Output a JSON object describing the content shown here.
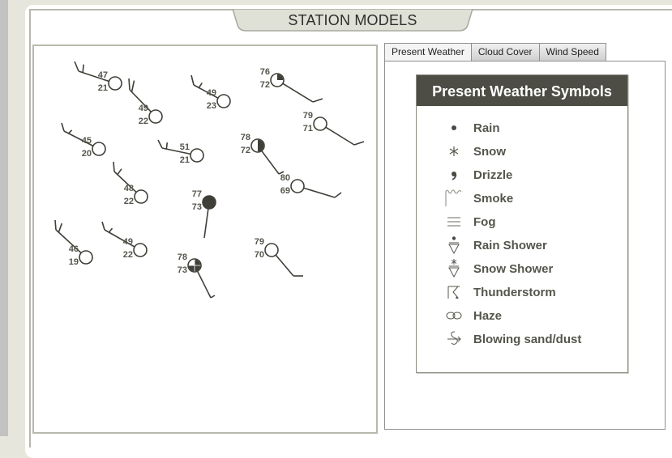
{
  "header": {
    "title": "STATION MODELS"
  },
  "tabs": [
    {
      "label": "Present Weather",
      "active": true
    },
    {
      "label": "Cloud Cover",
      "active": false
    },
    {
      "label": "Wind Speed",
      "active": false
    }
  ],
  "legend": {
    "title": "Present Weather Symbols",
    "items": [
      {
        "icon": "rain-icon",
        "label": "Rain"
      },
      {
        "icon": "snow-icon",
        "label": "Snow"
      },
      {
        "icon": "drizzle-icon",
        "label": "Drizzle"
      },
      {
        "icon": "smoke-icon",
        "label": "Smoke"
      },
      {
        "icon": "fog-icon",
        "label": "Fog"
      },
      {
        "icon": "rain-shower-icon",
        "label": "Rain Shower"
      },
      {
        "icon": "snow-shower-icon",
        "label": "Snow Shower"
      },
      {
        "icon": "thunderstorm-icon",
        "label": "Thunderstorm"
      },
      {
        "icon": "haze-icon",
        "label": "Haze"
      },
      {
        "icon": "blowing-sand-icon",
        "label": "Blowing sand/dust"
      }
    ]
  },
  "colors": {
    "ink": "#3f3f38",
    "header_bg": "#4d4d45",
    "frame_bg": "#e6e6dc",
    "border": "#b8b9ad"
  },
  "stations": [
    {
      "temp": "47",
      "dew": "21",
      "cover": "clear",
      "wind_from": "WNW",
      "barbs": "2 full"
    },
    {
      "temp": "49",
      "dew": "22",
      "cover": "clear",
      "wind_from": "NW",
      "barbs": "2 full"
    },
    {
      "temp": "49",
      "dew": "23",
      "cover": "clear",
      "wind_from": "WNW",
      "barbs": "1 full + half"
    },
    {
      "temp": "76",
      "dew": "72",
      "cover": "scattered",
      "wind_from": "SE",
      "barbs": "1 full"
    },
    {
      "temp": "79",
      "dew": "71",
      "cover": "clear",
      "wind_from": "SE",
      "barbs": "1 full"
    },
    {
      "temp": "45",
      "dew": "20",
      "cover": "clear",
      "wind_from": "WNW",
      "barbs": "1 full + half"
    },
    {
      "temp": "51",
      "dew": "21",
      "cover": "clear",
      "wind_from": "W",
      "barbs": "2 full"
    },
    {
      "temp": "78",
      "dew": "72",
      "cover": "broken-half",
      "wind_from": "SE",
      "barbs": "half"
    },
    {
      "temp": "80",
      "dew": "69",
      "cover": "clear",
      "wind_from": "ESE",
      "barbs": "1 full"
    },
    {
      "temp": "48",
      "dew": "22",
      "cover": "clear",
      "wind_from": "NW",
      "barbs": "1 full + half"
    },
    {
      "temp": "77",
      "dew": "73",
      "cover": "overcast",
      "wind_from": "S",
      "barbs": "none"
    },
    {
      "temp": "46",
      "dew": "19",
      "cover": "clear",
      "wind_from": "NW",
      "barbs": "2 full"
    },
    {
      "temp": "49",
      "dew": "22",
      "cover": "clear",
      "wind_from": "WNW",
      "barbs": "1 full + half"
    },
    {
      "temp": "78",
      "dew": "73",
      "cover": "three-quarter",
      "wind_from": "SSE",
      "barbs": "half"
    },
    {
      "temp": "79",
      "dew": "70",
      "cover": "clear",
      "wind_from": "SE",
      "barbs": "1 full"
    }
  ]
}
